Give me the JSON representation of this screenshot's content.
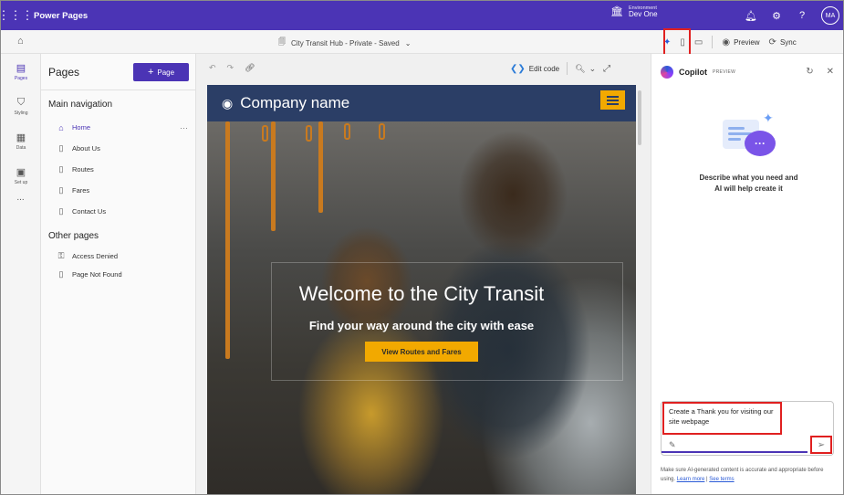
{
  "app": {
    "title": "Power Pages",
    "waffle_icon": "waffle-icon"
  },
  "environment": {
    "label": "Environment",
    "name": "Dev One"
  },
  "user": {
    "initials": "MA"
  },
  "command_bar": {
    "site_title": "City Transit Hub - Private - Saved",
    "preview_label": "Preview",
    "sync_label": "Sync"
  },
  "rail": {
    "items": [
      {
        "label": "Pages",
        "icon": "pages-icon"
      },
      {
        "label": "Styling",
        "icon": "styling-icon"
      },
      {
        "label": "Data",
        "icon": "data-icon"
      },
      {
        "label": "Set up",
        "icon": "setup-icon"
      }
    ],
    "more": "..."
  },
  "pages_panel": {
    "title": "Pages",
    "add_button": "Page",
    "main_nav_title": "Main navigation",
    "main_nav": [
      "Home",
      "About Us",
      "Routes",
      "Fares",
      "Contact Us"
    ],
    "other_title": "Other pages",
    "other_pages": [
      "Access Denied",
      "Page Not Found"
    ]
  },
  "canvas": {
    "edit_code_label": "Edit code"
  },
  "site": {
    "company_name": "Company name",
    "hero_title": "Welcome to the City Transit",
    "hero_subtitle": "Find your way around the city with ease",
    "hero_button": "View Routes and Fares"
  },
  "copilot": {
    "title": "Copilot",
    "badge": "PREVIEW",
    "description_line1": "Describe what you need and",
    "description_line2": "AI will help create it",
    "prompt_text": "Create a Thank you for visiting our site webpage",
    "disclaimer_text": "Make sure AI-generated content is accurate and appropriate before using.",
    "learn_more": "Learn more",
    "separator": "|",
    "see_terms": "See terms"
  },
  "colors": {
    "brand": "#4b34b5",
    "accent": "#f2a900",
    "header": "#2b3e66",
    "highlight": "#e02020"
  }
}
